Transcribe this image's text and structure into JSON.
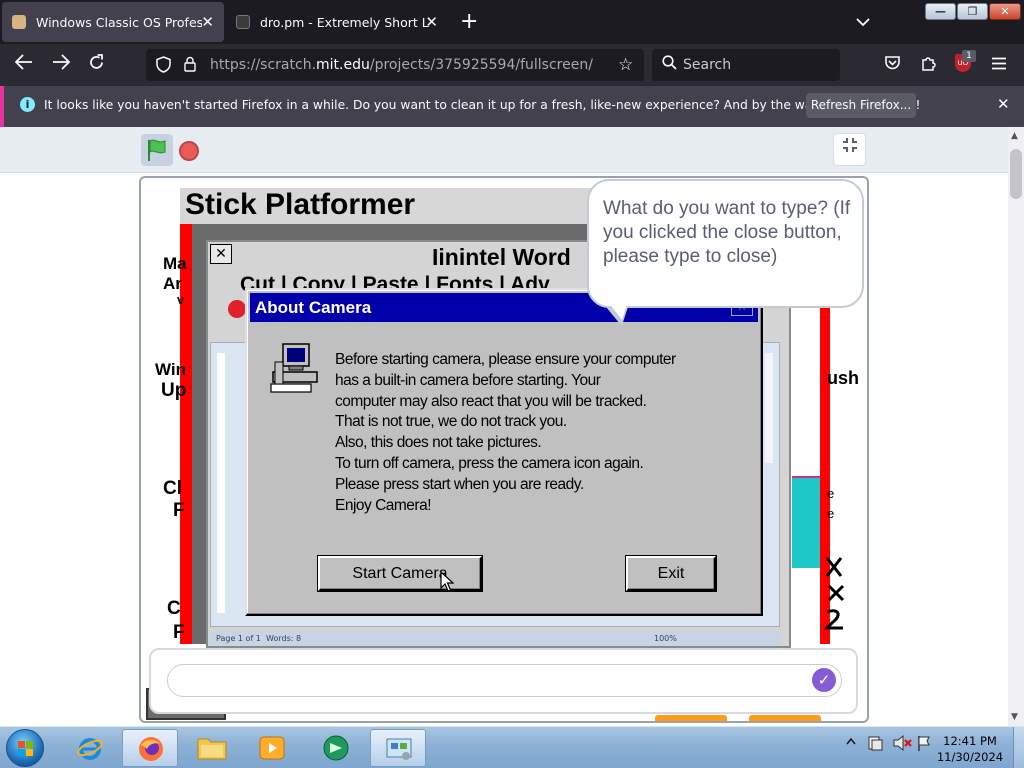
{
  "browser": {
    "tabs": [
      {
        "title": "Windows Classic OS Professional",
        "active": true
      },
      {
        "title": "dro.pm - Extremely Short Links",
        "active": false
      }
    ],
    "url": {
      "prefix": "https://scratch.",
      "host": "mit.edu",
      "path": "/projects/375925594/fullscreen/"
    },
    "search_placeholder": "Search",
    "extension_badge": "1",
    "notification": {
      "message": "It looks like you haven't started Firefox in a while. Do you want to clean it up for a fresh, like-new experience? And by the way, welcome back!",
      "button": "Refresh Firefox..."
    }
  },
  "game": {
    "title": "Stick Platformer",
    "word_title": "Iinintel Word",
    "word_menu": "Cut | Copy | Paste | Fonts    | Adv",
    "left_fragments": [
      "Ma",
      "Ar",
      "v",
      "Win",
      "Up",
      "Cl",
      "F",
      "C",
      "F"
    ],
    "right_fragments": [
      "ush",
      "e",
      "e"
    ],
    "word_status": [
      "Page 1 of 1",
      "Words: 8"
    ],
    "word_zoom": "100%"
  },
  "speech_bubble": {
    "text": "What do you want to type? (If you clicked the close button, please type to close)"
  },
  "dialog": {
    "title": "About Camera",
    "lines": [
      "Before starting camera, please ensure your computer",
      "has a built-in camera before starting. Your",
      "computer may also react that you will be tracked.",
      "That is not true, we do not track you.",
      "Also, this does not take pictures.",
      "To turn off camera, press the camera icon again.",
      "Please press start when you are ready.",
      "Enjoy Camera!"
    ],
    "start_label": "Start Camera",
    "exit_label": "Exit"
  },
  "taskbar": {
    "time": "12:41 PM",
    "date": "11/30/2024"
  }
}
